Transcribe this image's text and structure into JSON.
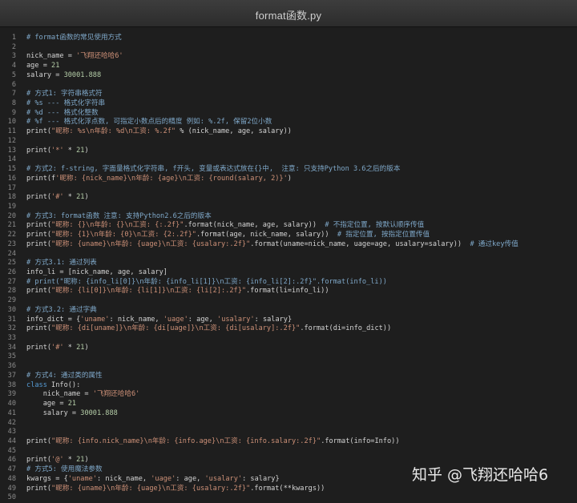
{
  "window": {
    "title": "format函数.py"
  },
  "watermark": "知乎 @飞翔还哈哈6",
  "lines": [
    {
      "n": "1",
      "tokens": [
        {
          "t": "# format函数的常见使用方式",
          "c": "c"
        }
      ]
    },
    {
      "n": "2",
      "tokens": []
    },
    {
      "n": "3",
      "tokens": [
        {
          "t": "nick_name = "
        },
        {
          "t": "'飞翔还哈哈6'",
          "c": "s"
        }
      ]
    },
    {
      "n": "4",
      "tokens": [
        {
          "t": "age = "
        },
        {
          "t": "21",
          "c": "n"
        }
      ]
    },
    {
      "n": "5",
      "tokens": [
        {
          "t": "salary = "
        },
        {
          "t": "30001.888",
          "c": "n"
        }
      ]
    },
    {
      "n": "6",
      "tokens": []
    },
    {
      "n": "7",
      "tokens": [
        {
          "t": "# 方式1: 字符串格式符",
          "c": "c"
        }
      ]
    },
    {
      "n": "8",
      "tokens": [
        {
          "t": "# %s --- 格式化字符串",
          "c": "c"
        }
      ]
    },
    {
      "n": "9",
      "tokens": [
        {
          "t": "# %d --- 格式化整数",
          "c": "c"
        }
      ]
    },
    {
      "n": "10",
      "tokens": [
        {
          "t": "# %f --- 格式化浮点数, 可指定小数点后的精度 例如: %.2f, 保留2位小数",
          "c": "c"
        }
      ]
    },
    {
      "n": "11",
      "tokens": [
        {
          "t": "print("
        },
        {
          "t": "\"昵称: %s\\n年龄: %d\\n工资: %.2f\"",
          "c": "s"
        },
        {
          "t": " % (nick_name, age, salary))"
        }
      ]
    },
    {
      "n": "12",
      "tokens": []
    },
    {
      "n": "13",
      "tokens": [
        {
          "t": "print("
        },
        {
          "t": "'*'",
          "c": "s"
        },
        {
          "t": " * "
        },
        {
          "t": "21",
          "c": "n"
        },
        {
          "t": ")"
        }
      ]
    },
    {
      "n": "14",
      "tokens": []
    },
    {
      "n": "15",
      "tokens": [
        {
          "t": "# 方式2: f-string, 字面量格式化字符串, f开头, 变量或表达式放在{}中,  注意: 只支持Python 3.6之后的版本",
          "c": "c"
        }
      ]
    },
    {
      "n": "16",
      "tokens": [
        {
          "t": "print(f"
        },
        {
          "t": "'昵称: {nick_name}\\n年龄: {age}\\n工资: {round(salary, 2)}'",
          "c": "s"
        },
        {
          "t": ")"
        }
      ]
    },
    {
      "n": "17",
      "tokens": []
    },
    {
      "n": "18",
      "tokens": [
        {
          "t": "print("
        },
        {
          "t": "'#'",
          "c": "s"
        },
        {
          "t": " * "
        },
        {
          "t": "21",
          "c": "n"
        },
        {
          "t": ")"
        }
      ]
    },
    {
      "n": "19",
      "tokens": []
    },
    {
      "n": "20",
      "tokens": [
        {
          "t": "# 方式3: format函数 注意: 支持Python2.6之后的版本",
          "c": "c"
        }
      ]
    },
    {
      "n": "21",
      "tokens": [
        {
          "t": "print("
        },
        {
          "t": "\"昵称: {}\\n年龄: {}\\n工资: {:.2f}\"",
          "c": "s"
        },
        {
          "t": ".format(nick_name, age, salary))  "
        },
        {
          "t": "# 不指定位置, 按默认顺序传值",
          "c": "c"
        }
      ]
    },
    {
      "n": "22",
      "tokens": [
        {
          "t": "print("
        },
        {
          "t": "\"昵称: {1}\\n年龄: {0}\\n工资: {2:.2f}\"",
          "c": "s"
        },
        {
          "t": ".format(age, nick_name, salary))  "
        },
        {
          "t": "# 指定位置, 按指定位置传值",
          "c": "c"
        }
      ]
    },
    {
      "n": "23",
      "tokens": [
        {
          "t": "print("
        },
        {
          "t": "\"昵称: {uname}\\n年龄: {uage}\\n工资: {usalary:.2f}\"",
          "c": "s"
        },
        {
          "t": ".format(uname=nick_name, uage=age, usalary=salary))  "
        },
        {
          "t": "# 通过key传值",
          "c": "c"
        }
      ]
    },
    {
      "n": "24",
      "tokens": []
    },
    {
      "n": "25",
      "tokens": [
        {
          "t": "# 方式3.1: 通过列表",
          "c": "c"
        }
      ]
    },
    {
      "n": "26",
      "tokens": [
        {
          "t": "info_li = [nick_name, age, salary]"
        }
      ]
    },
    {
      "n": "27",
      "tokens": [
        {
          "t": "# print(\"昵称: {info_li[0]}\\n年龄: {info_li[1]}\\n工资: {info_li[2]:.2f}\".format(info_li))",
          "c": "c"
        }
      ]
    },
    {
      "n": "28",
      "tokens": [
        {
          "t": "print("
        },
        {
          "t": "\"昵称: {li[0]}\\n年龄: {li[1]}\\n工资: {li[2]:.2f}\"",
          "c": "s"
        },
        {
          "t": ".format(li=info_li))"
        }
      ]
    },
    {
      "n": "29",
      "tokens": []
    },
    {
      "n": "30",
      "tokens": [
        {
          "t": "# 方式3.2: 通过字典",
          "c": "c"
        }
      ]
    },
    {
      "n": "31",
      "tokens": [
        {
          "t": "info_dict = {"
        },
        {
          "t": "'uname'",
          "c": "s"
        },
        {
          "t": ": nick_name, "
        },
        {
          "t": "'uage'",
          "c": "s"
        },
        {
          "t": ": age, "
        },
        {
          "t": "'usalary'",
          "c": "s"
        },
        {
          "t": ": salary}"
        }
      ]
    },
    {
      "n": "32",
      "tokens": [
        {
          "t": "print("
        },
        {
          "t": "\"昵称: {di[uname]}\\n年龄: {di[uage]}\\n工资: {di[usalary]:.2f}\"",
          "c": "s"
        },
        {
          "t": ".format(di=info_dict))"
        }
      ]
    },
    {
      "n": "33",
      "tokens": []
    },
    {
      "n": "34",
      "tokens": [
        {
          "t": "print("
        },
        {
          "t": "'#'",
          "c": "s"
        },
        {
          "t": " * "
        },
        {
          "t": "21",
          "c": "n"
        },
        {
          "t": ")"
        }
      ]
    },
    {
      "n": "35",
      "tokens": []
    },
    {
      "n": "36",
      "tokens": []
    },
    {
      "n": "37",
      "tokens": [
        {
          "t": "# 方式4: 通过类的属性",
          "c": "c"
        }
      ]
    },
    {
      "n": "38",
      "tokens": [
        {
          "t": "class",
          "c": "k"
        },
        {
          "t": " Info():"
        }
      ]
    },
    {
      "n": "39",
      "tokens": [
        {
          "t": "    nick_name = "
        },
        {
          "t": "'飞翔还哈哈6'",
          "c": "s"
        }
      ]
    },
    {
      "n": "40",
      "tokens": [
        {
          "t": "    age = "
        },
        {
          "t": "21",
          "c": "n"
        }
      ]
    },
    {
      "n": "41",
      "tokens": [
        {
          "t": "    salary = "
        },
        {
          "t": "30001.888",
          "c": "n"
        }
      ]
    },
    {
      "n": "42",
      "tokens": []
    },
    {
      "n": "43",
      "tokens": []
    },
    {
      "n": "44",
      "tokens": [
        {
          "t": "print("
        },
        {
          "t": "\"昵称: {info.nick_name}\\n年龄: {info.age}\\n工资: {info.salary:.2f}\"",
          "c": "s"
        },
        {
          "t": ".format(info=Info))"
        }
      ]
    },
    {
      "n": "45",
      "tokens": []
    },
    {
      "n": "46",
      "tokens": [
        {
          "t": "print("
        },
        {
          "t": "'@'",
          "c": "s"
        },
        {
          "t": " * "
        },
        {
          "t": "21",
          "c": "n"
        },
        {
          "t": ")"
        }
      ]
    },
    {
      "n": "47",
      "tokens": [
        {
          "t": "# 方式5: 使用魔法参数",
          "c": "c"
        }
      ]
    },
    {
      "n": "48",
      "tokens": [
        {
          "t": "kwargs = {"
        },
        {
          "t": "'uname'",
          "c": "s"
        },
        {
          "t": ": nick_name, "
        },
        {
          "t": "'uage'",
          "c": "s"
        },
        {
          "t": ": age, "
        },
        {
          "t": "'usalary'",
          "c": "s"
        },
        {
          "t": ": salary}"
        }
      ]
    },
    {
      "n": "49",
      "tokens": [
        {
          "t": "print("
        },
        {
          "t": "\"昵称: {uname}\\n年龄: {uage}\\n工资: {usalary:.2f}\"",
          "c": "s"
        },
        {
          "t": ".format(**kwargs))"
        }
      ]
    },
    {
      "n": "50",
      "tokens": []
    }
  ]
}
